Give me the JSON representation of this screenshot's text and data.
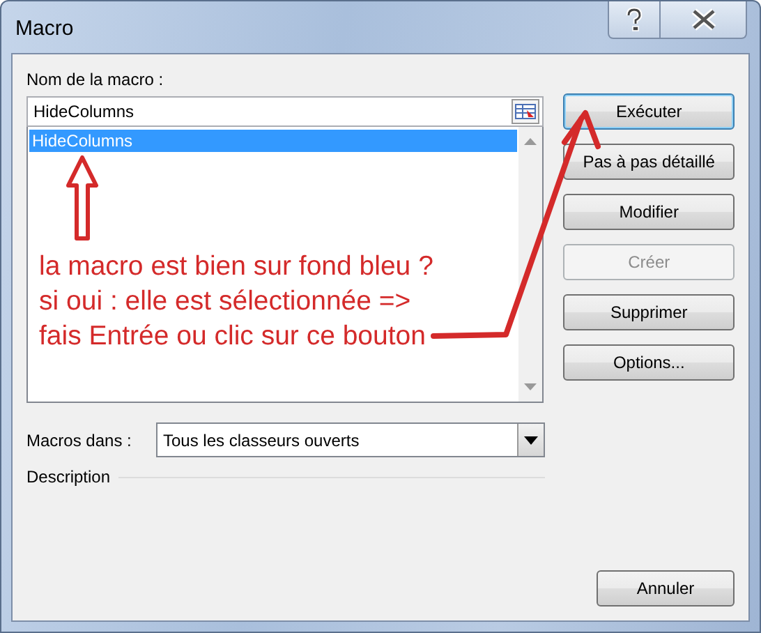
{
  "window": {
    "title": "Macro"
  },
  "macro_name": {
    "label": "Nom de la macro :",
    "value": "HideColumns"
  },
  "macro_list": {
    "items": [
      {
        "label": "HideColumns",
        "selected": true
      }
    ]
  },
  "buttons": [
    {
      "label": "Exécuter",
      "disabled": false,
      "default": true
    },
    {
      "label": "Pas à pas détaillé",
      "disabled": false,
      "default": false
    },
    {
      "label": "Modifier",
      "disabled": false,
      "default": false
    },
    {
      "label": "Créer",
      "disabled": true,
      "default": false
    },
    {
      "label": "Supprimer",
      "disabled": false,
      "default": false
    },
    {
      "label": "Options...",
      "disabled": false,
      "default": false
    }
  ],
  "macros_in": {
    "label": "Macros dans :",
    "value": "Tous les classeurs ouverts"
  },
  "description": {
    "label": "Description"
  },
  "cancel_button": {
    "label": "Annuler"
  },
  "annotation": {
    "lines": [
      "la macro est bien sur fond bleu ?",
      "si oui : elle est sélectionnée =>",
      "fais Entrée ou clic sur ce bouton"
    ]
  }
}
